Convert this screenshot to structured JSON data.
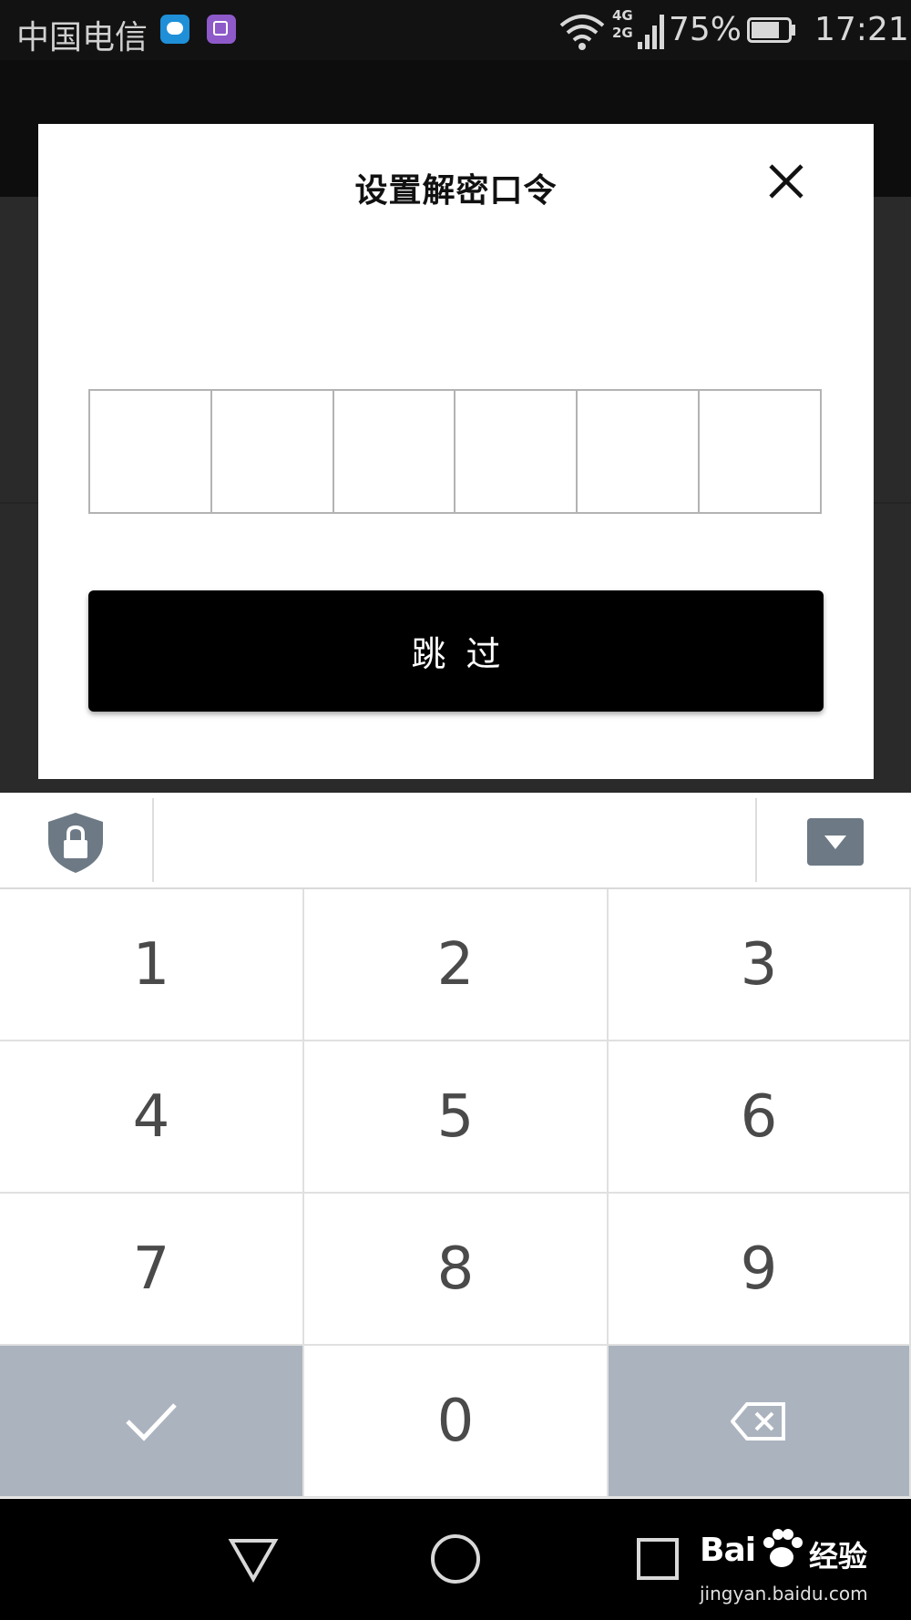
{
  "status_bar": {
    "carrier": "中国电信",
    "network": [
      "4G",
      "2G"
    ],
    "battery_percent": "75%",
    "battery_level": 0.75,
    "time": "17:21"
  },
  "dialog": {
    "title": "设置解密口令",
    "code_box_count": 6,
    "skip_label": "跳过"
  },
  "keyboard": {
    "keys": [
      "1",
      "2",
      "3",
      "4",
      "5",
      "6",
      "7",
      "8",
      "9",
      "confirm",
      "0",
      "delete"
    ]
  },
  "watermark": {
    "logo_left": "Bai",
    "logo_right": "经验",
    "url": "jingyan.baidu.com"
  },
  "colors": {
    "function_key": "#abb3bf",
    "skip_button": "#000000"
  }
}
